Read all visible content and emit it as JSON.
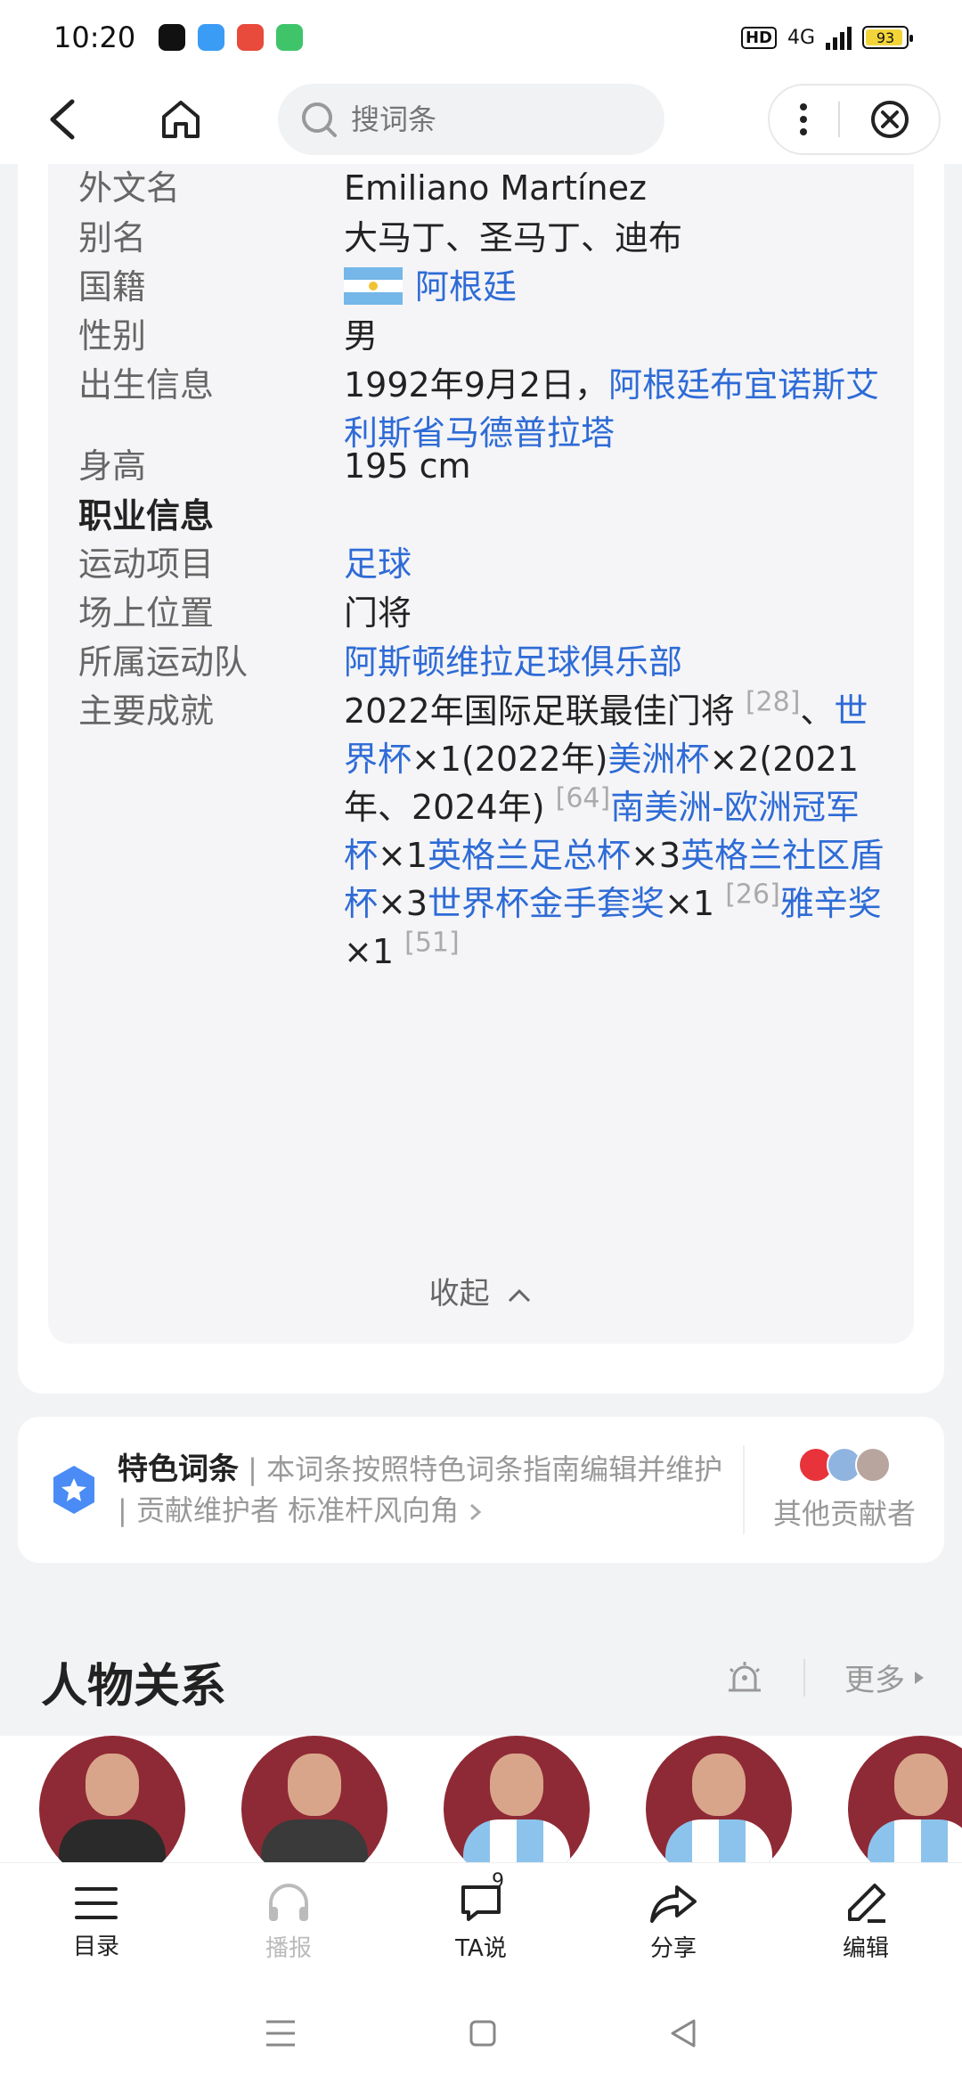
{
  "status_bar": {
    "time": "10:20",
    "network": "4G",
    "battery": "93",
    "battery_fill": 0.93
  },
  "nav": {
    "search_placeholder": "搜词条"
  },
  "infobox": {
    "foreign_name": {
      "label": "外文名",
      "value": "Emiliano Martínez"
    },
    "alias": {
      "label": "别名",
      "value": "大马丁、圣马丁、迪布"
    },
    "nationality": {
      "label": "国籍",
      "value": "阿根廷"
    },
    "gender": {
      "label": "性别",
      "value": "男"
    },
    "birth": {
      "label": "出生信息",
      "date": "1992年9月2日，",
      "place": "阿根廷布宜诺斯艾利斯省马德普拉塔"
    },
    "height": {
      "label": "身高",
      "value": "195 cm"
    },
    "career_header": "职业信息",
    "sport": {
      "label": "运动项目",
      "value": "足球"
    },
    "position": {
      "label": "场上位置",
      "value": "门将"
    },
    "team": {
      "label": "所属运动队",
      "value": "阿斯顿维拉足球俱乐部"
    },
    "achievements": {
      "label": "主要成就",
      "t1": "2022年国际足联最佳门将",
      "r1": "[28]",
      "t2": "、",
      "l1": "世界杯",
      "t3": "×1(2022年)",
      "l2": "美洲杯",
      "t4": "×2(2021年、2024年)",
      "r2": "[64]",
      "l3": "南美洲-欧洲冠军杯",
      "t5": "×1",
      "l4": "英格兰足总杯",
      "t6": "×3",
      "l5": "英格兰社区盾杯",
      "t7": "×3",
      "l6": "世界杯金手套奖",
      "t8": "×1",
      "r3": "[26]",
      "l7": "雅辛奖",
      "t9": "×1",
      "r4": "[51]"
    },
    "collapse": "收起"
  },
  "featured": {
    "title": "特色词条",
    "sep": "|",
    "desc": "本词条按照特色词条指南编辑并维护",
    "sep2": "|",
    "maintainer_label": "贡献维护者",
    "maintainer": "标准杆风向角",
    "others": "其他贡献者"
  },
  "relations": {
    "title": "人物关系",
    "more": "更多"
  },
  "bottom_tabs": [
    {
      "label": "目录",
      "icon": "list-icon"
    },
    {
      "label": "播报",
      "icon": "headphones-icon"
    },
    {
      "label": "TA说",
      "icon": "comment-icon",
      "badge": "9"
    },
    {
      "label": "分享",
      "icon": "share-icon"
    },
    {
      "label": "编辑",
      "icon": "edit-icon"
    }
  ],
  "colors": {
    "link": "#2e6bd6",
    "accent_star": "#4a8bf5"
  }
}
